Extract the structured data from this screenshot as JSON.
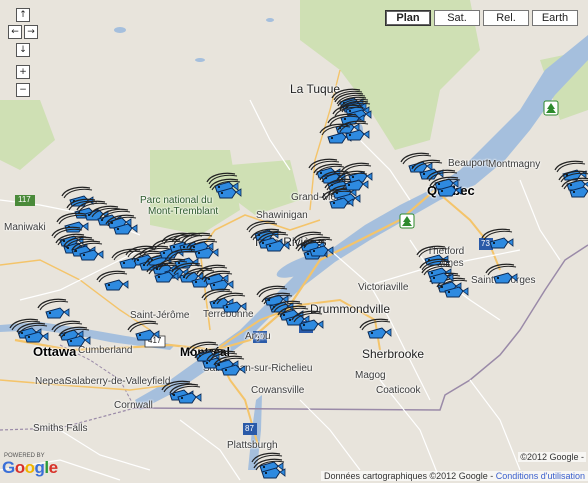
{
  "map_type_control": {
    "buttons": [
      {
        "label": "Plan",
        "active": true
      },
      {
        "label": "Sat.",
        "active": false
      },
      {
        "label": "Rel.",
        "active": false
      },
      {
        "label": "Earth",
        "active": false
      }
    ]
  },
  "nav_control": {
    "pan_up": "↑",
    "pan_left": "←",
    "pan_right": "→",
    "pan_down": "↓",
    "zoom_in": "+",
    "zoom_out": "−"
  },
  "places": {
    "la_tuque": "La Tuque",
    "beauport": "Beauport",
    "montmagny": "Montmagny",
    "quebec": "Québec",
    "grand_mere": "Grand-Mère",
    "shawinigan": "Shawinigan",
    "trois_rivieres": "Trois-Rivières",
    "victoriaville": "Victoriaville",
    "thetford_mines_a": "Thetford",
    "thetford_mines_b": "Mines",
    "saint_georges": "Saint-Georges",
    "drummondville": "Drummondville",
    "saint_jerome": "Saint-Jérôme",
    "terrebonne": "Terrebonne",
    "montreal": "Montréal",
    "anjou": "Anjou",
    "saint_jean": "Saint-Jean-sur-Richelieu",
    "sherbrooke": "Sherbrooke",
    "magog": "Magog",
    "coaticook": "Coaticook",
    "cowansville": "Cowansville",
    "ottawa": "Ottawa",
    "cumberland": "Cumberland",
    "nepean": "Nepean",
    "salaberry": "Salaberry-de-Valleyfield",
    "cornwall": "Cornwall",
    "smiths_falls": "Smiths Falls",
    "plattsburgh": "Plattsburgh",
    "maniwaki": "Maniwaki",
    "park_1": "Parc national du",
    "park_2": "Mont-Tremblant"
  },
  "route_shields": {
    "r117": "117",
    "r417": "417",
    "r20a": "20",
    "r20b": "20",
    "r73": "73",
    "r87": "87"
  },
  "logo": {
    "powered_by": "POWERED BY",
    "letters": [
      "G",
      "o",
      "o",
      "g",
      "l",
      "e"
    ]
  },
  "copyright": "©2012 Google -",
  "attribution": {
    "text": "Données cartographiques ©2012 Google - ",
    "link": "Conditions d'utilisation"
  },
  "colors": {
    "land": "#e8e4dc",
    "water": "#a5bfdd",
    "forest": "#cfe0b4",
    "highway": "#f4c46a",
    "road": "#ffffff",
    "border": "#9a8aa8",
    "marker_fill": "#2e8ae0",
    "marker_stroke": "#0b2a55"
  },
  "markers": {
    "count": 75,
    "icon": "fishing-hook-fish-icon"
  }
}
